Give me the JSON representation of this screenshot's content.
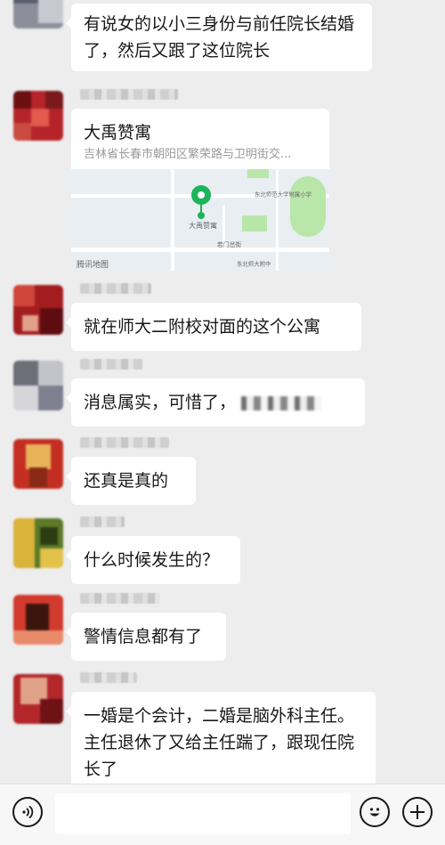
{
  "messages": [
    {
      "type": "text",
      "text": "有说女的以小三身份与前任院长结婚了，然后又跟了这位院长"
    },
    {
      "type": "location",
      "title": "大禹赞寓",
      "address": "吉林省长春市朝阳区繁荣路与卫明街交...",
      "map_credit": "腾讯地图",
      "map_labels": [
        "大禹赞寓",
        "东北师范大学附属小学",
        "东北师大附中",
        "若门岔街"
      ]
    },
    {
      "type": "text",
      "text": "就在师大二附校对面的这个公寓"
    },
    {
      "type": "text",
      "text": "消息属实，可惜了，"
    },
    {
      "type": "text",
      "text": "还真是真的"
    },
    {
      "type": "text",
      "text": "什么时候发生的？"
    },
    {
      "type": "text",
      "text": "警情信息都有了"
    },
    {
      "type": "text",
      "text": "一婚是个会计，二婚是脑外科主任。主任退休了又给主任踹了，跟现任院长了"
    }
  ],
  "input": {
    "value": "",
    "placeholder": ""
  },
  "icons": {
    "voice": "voice-icon",
    "emoji": "emoji-icon",
    "plus": "plus-icon"
  },
  "colors": {
    "background": "#ededed",
    "bubble": "#ffffff",
    "pin": "#1db45a"
  }
}
